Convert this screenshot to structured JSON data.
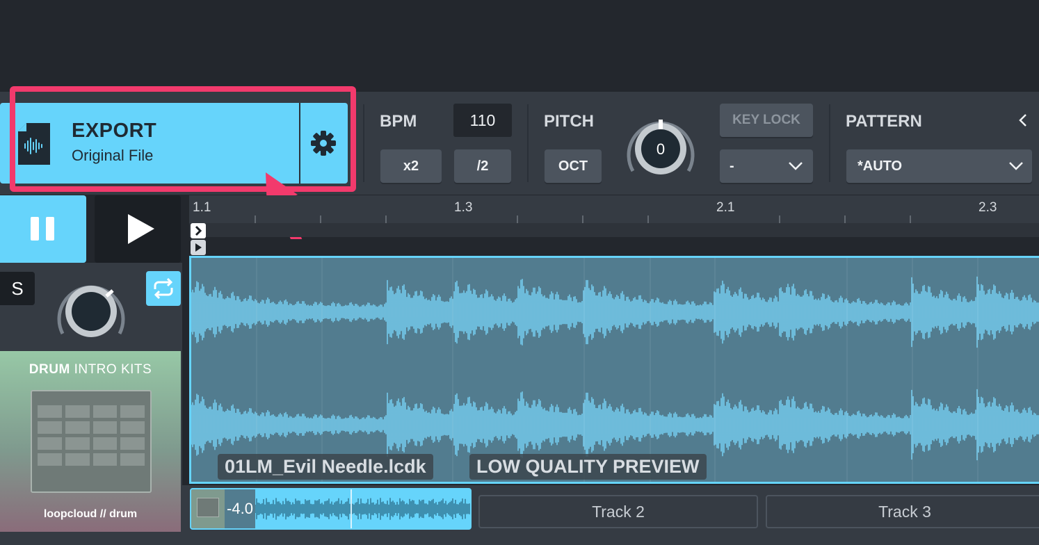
{
  "export": {
    "title": "EXPORT",
    "subtitle": "Original File"
  },
  "bpm": {
    "label": "BPM",
    "value": "110",
    "double_label": "x2",
    "half_label": "/2"
  },
  "pitch": {
    "label": "PITCH",
    "oct_label": "OCT",
    "knob_value": "0"
  },
  "keylock": {
    "label": "KEY LOCK",
    "key_select": "-"
  },
  "pattern": {
    "label": "PATTERN",
    "select_value": "*AUTO"
  },
  "transport": {
    "solo_label": "S"
  },
  "ruler": {
    "ticks": [
      "1.1",
      "1.3",
      "2.1",
      "2.3"
    ]
  },
  "waveform": {
    "filename": "01LM_Evil Needle.lcdk",
    "quality_tag": "LOW QUALITY PREVIEW"
  },
  "cover": {
    "title_bold": "DRUM",
    "title_rest": " INTRO KITS",
    "brand": "loopcloud // drum"
  },
  "tracks": {
    "track1_gain": "-4.0",
    "track2_label": "Track 2",
    "track3_label": "Track 3"
  },
  "colors": {
    "accent": "#66d4fb",
    "highlight": "#f23a6c",
    "panel": "#353b43",
    "background": "#23272d"
  },
  "icons": [
    "audio-file-icon",
    "gear-icon",
    "pause-icon",
    "play-icon",
    "loop-icon",
    "chevron-left-icon",
    "chevron-down-icon",
    "knob-icon"
  ]
}
